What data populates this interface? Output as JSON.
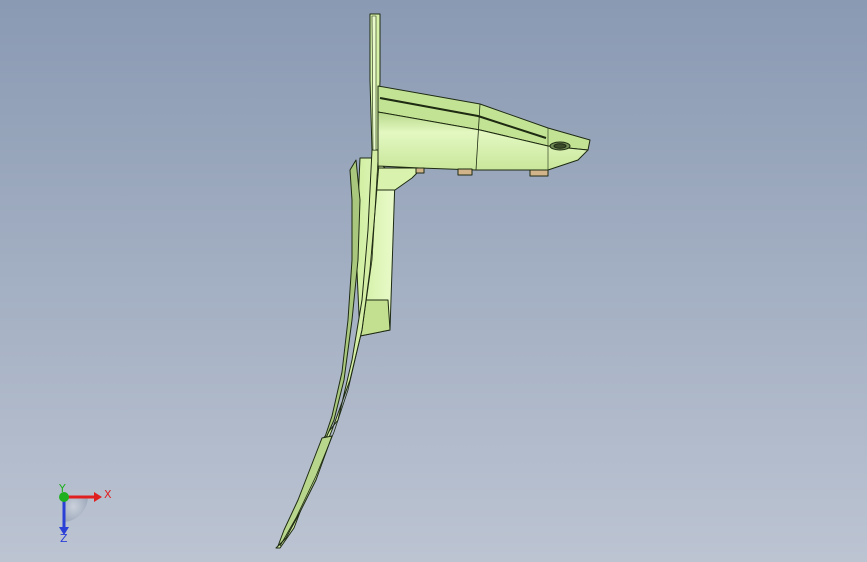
{
  "viewport": {
    "background_top": "#8a9ab3",
    "background_bottom": "#bcc4d2"
  },
  "model": {
    "face_color": "#d6f2a8",
    "face_highlight": "#eafbcb",
    "face_shadow": "#a9c87e",
    "edge_color": "#1e2a12",
    "tab_color": "#d2b48a"
  },
  "triad": {
    "x_label": "X",
    "y_label": "Y",
    "z_label": "Z",
    "x_color": "#e02020",
    "y_color": "#1fb01f",
    "z_color": "#2a3fd6"
  }
}
